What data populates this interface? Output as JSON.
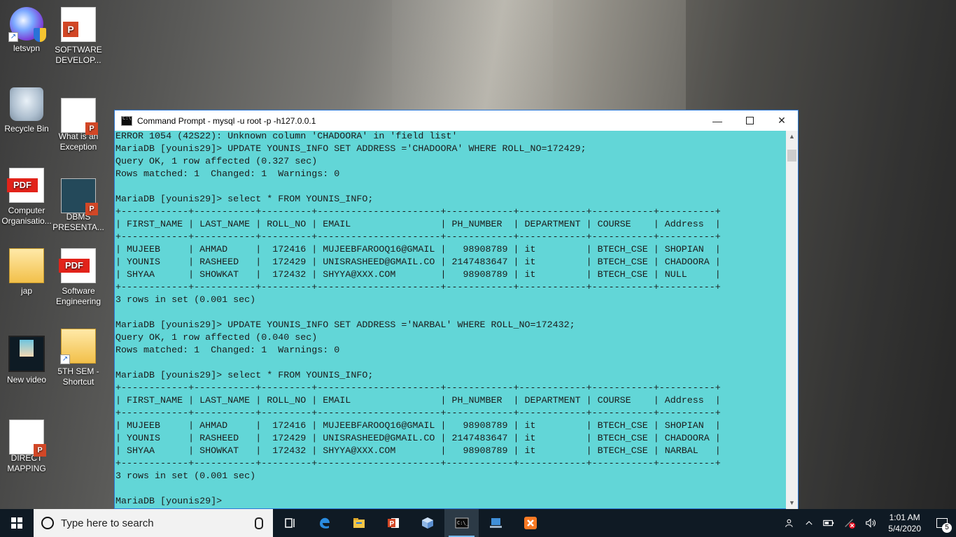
{
  "desktop": {
    "icons": [
      {
        "label": "letsvpn"
      },
      {
        "label": "SOFTWARE DEVELOP..."
      },
      {
        "label": "Recycle Bin"
      },
      {
        "label": "What is an Exception"
      },
      {
        "label": "Computer Organisatio..."
      },
      {
        "label": "DBMS PRESENTA..."
      },
      {
        "label": "jap"
      },
      {
        "label": "Software Engineering"
      },
      {
        "label": "New video"
      },
      {
        "label": "5TH SEM - Shortcut"
      },
      {
        "label": "DIRECT MAPPING"
      }
    ]
  },
  "window": {
    "title": "Command Prompt - mysql  -u root -p -h127.0.0.1",
    "minimize_glyph": "—",
    "close_glyph": "✕",
    "console_text": "ERROR 1054 (42S22): Unknown column 'CHADOORA' in 'field list'\nMariaDB [younis29]> UPDATE YOUNIS_INFO SET ADDRESS ='CHADOORA' WHERE ROLL_NO=172429;\nQuery OK, 1 row affected (0.327 sec)\nRows matched: 1  Changed: 1  Warnings: 0\n\nMariaDB [younis29]> select * FROM YOUNIS_INFO;\n+------------+-----------+---------+----------------------+------------+------------+-----------+----------+\n| FIRST_NAME | LAST_NAME | ROLL_NO | EMAIL                | PH_NUMBER  | DEPARTMENT | COURSE    | Address  |\n+------------+-----------+---------+----------------------+------------+------------+-----------+----------+\n| MUJEEB     | AHMAD     |  172416 | MUJEEBFAROOQ16@GMAIL |   98908789 | it         | BTECH_CSE | SHOPIAN  |\n| YOUNIS     | RASHEED   |  172429 | UNISRASHEED@GMAIL.CO | 2147483647 | it         | BTECH_CSE | CHADOORA |\n| SHYAA      | SHOWKAT   |  172432 | SHYYA@XXX.COM        |   98908789 | it         | BTECH_CSE | NULL     |\n+------------+-----------+---------+----------------------+------------+------------+-----------+----------+\n3 rows in set (0.001 sec)\n\nMariaDB [younis29]> UPDATE YOUNIS_INFO SET ADDRESS ='NARBAL' WHERE ROLL_NO=172432;\nQuery OK, 1 row affected (0.040 sec)\nRows matched: 1  Changed: 1  Warnings: 0\n\nMariaDB [younis29]> select * FROM YOUNIS_INFO;\n+------------+-----------+---------+----------------------+------------+------------+-----------+----------+\n| FIRST_NAME | LAST_NAME | ROLL_NO | EMAIL                | PH_NUMBER  | DEPARTMENT | COURSE    | Address  |\n+------------+-----------+---------+----------------------+------------+------------+-----------+----------+\n| MUJEEB     | AHMAD     |  172416 | MUJEEBFAROOQ16@GMAIL |   98908789 | it         | BTECH_CSE | SHOPIAN  |\n| YOUNIS     | RASHEED   |  172429 | UNISRASHEED@GMAIL.CO | 2147483647 | it         | BTECH_CSE | CHADOORA |\n| SHYAA      | SHOWKAT   |  172432 | SHYYA@XXX.COM        |   98908789 | it         | BTECH_CSE | NARBAL   |\n+------------+-----------+---------+----------------------+------------+------------+-----------+----------+\n3 rows in set (0.001 sec)\n\nMariaDB [younis29]> "
  },
  "taskbar": {
    "search_placeholder": "Type here to search",
    "time": "1:01 AM",
    "date": "5/4/2020",
    "notification_count": "5",
    "pinned": [
      {
        "name": "task-view-icon"
      },
      {
        "name": "edge-icon"
      },
      {
        "name": "file-explorer-icon"
      },
      {
        "name": "powerpoint-icon"
      },
      {
        "name": "3d-viewer-icon"
      },
      {
        "name": "command-prompt-icon"
      },
      {
        "name": "connect-icon"
      },
      {
        "name": "xampp-icon"
      }
    ]
  },
  "colors": {
    "console_bg": "#62d6d7",
    "taskbar_bg": "#0f1a24",
    "window_border": "#2b79d8"
  }
}
